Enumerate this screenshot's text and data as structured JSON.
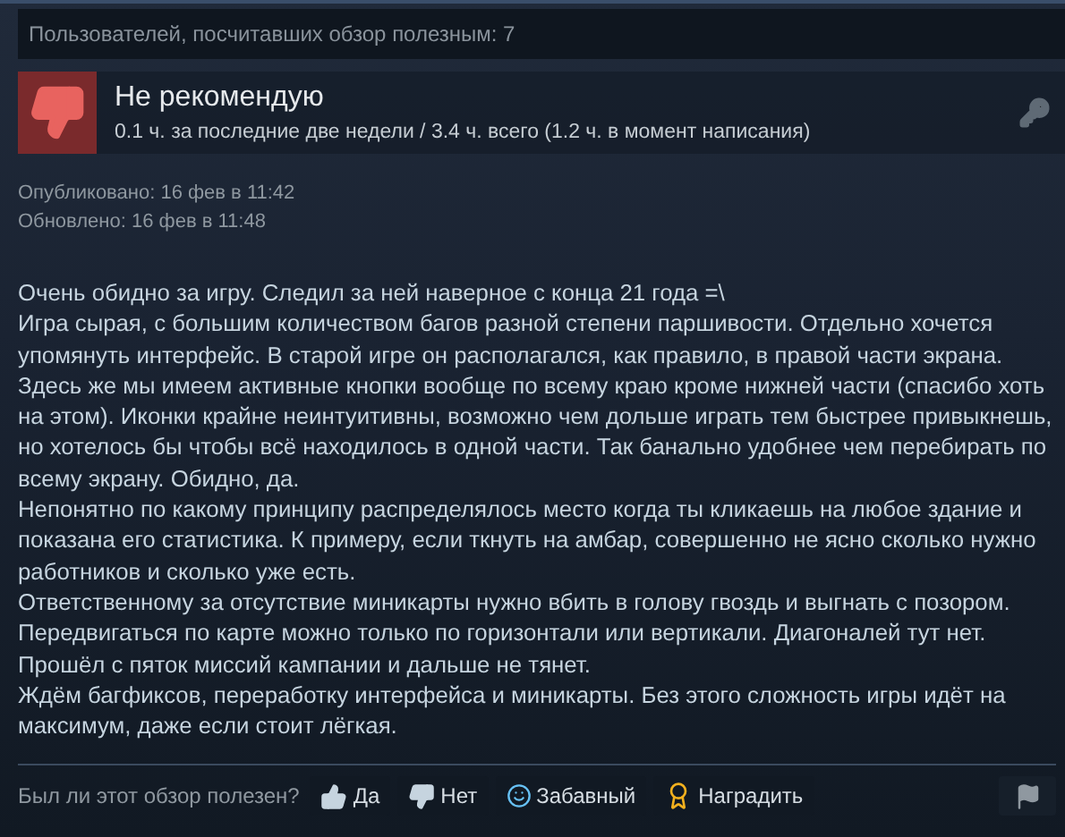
{
  "helpful_count": "Пользователей, посчитавших обзор полезным: 7",
  "review": {
    "recommended": false,
    "verdict": "Не рекомендую",
    "hours": "0.1 ч. за последние две недели / 3.4 ч. всего (1.2 ч. в момент написания)"
  },
  "dates": [
    "Опубликовано: 16 фев в 11:42",
    "Обновлено: 16 фев в 11:48"
  ],
  "body": [
    "Очень обидно за игру. Следил за ней наверное с конца 21 года =\\",
    "Игра сырая, с большим количеством багов разной степени паршивости. Отдельно хочется упомянуть интерфейс. В старой игре он располагался, как правило, в правой части экрана. Здесь же мы имеем активные кнопки вообще по всему краю кроме нижней части (спасибо хоть на этом). Иконки крайне неинтуитивны, возможно чем дольше играть тем быстрее привыкнешь, но хотелось бы чтобы всё находилось в одной части. Так банально удобнее чем перебирать по всему экрану. Обидно, да.",
    "Непонятно по какому принципу распределялось место когда ты кликаешь на любое здание и показана его статистика. К примеру, если ткнуть на амбар, совершенно не ясно сколько нужно работников и сколько уже есть.",
    "Ответственному за отсутствие миникарты нужно вбить в голову гвоздь и выгнать с позором.",
    "Передвигаться по карте можно только по горизонтали или вертикали. Диагоналей тут нет.",
    "Прошёл с пяток миссий кампании и дальше не тянет.",
    "Ждём багфиксов, переработку интерфейса и миникарты. Без этого сложность игры идёт на максимум, даже если стоит лёгкая."
  ],
  "footer": {
    "question": "Был ли этот обзор полезен?",
    "buttons": [
      {
        "kind": "yes",
        "label": "Да"
      },
      {
        "kind": "no",
        "label": "Нет"
      },
      {
        "kind": "funny",
        "label": "Забавный"
      },
      {
        "kind": "award",
        "label": "Наградить"
      }
    ]
  }
}
